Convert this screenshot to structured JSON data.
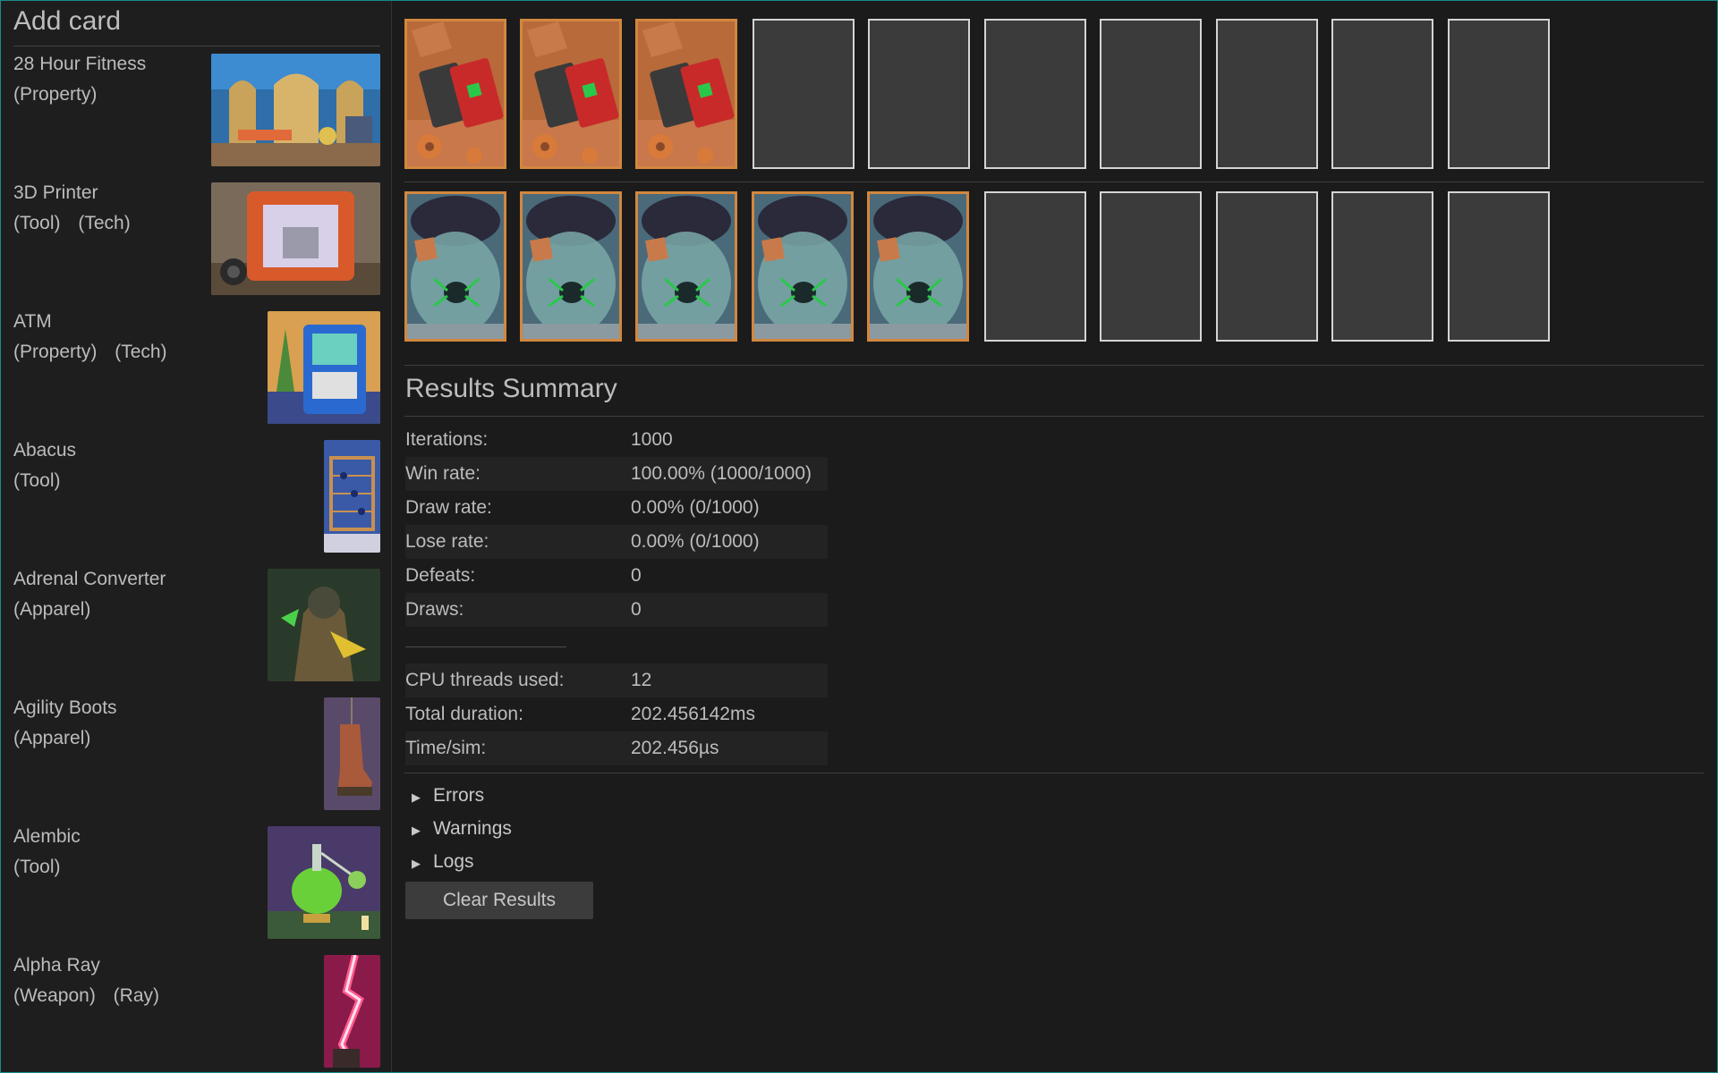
{
  "sidebar": {
    "title": "Add card",
    "cards": [
      {
        "name": "28 Hour Fitness",
        "tags": [
          "(Property)"
        ],
        "icon": "gym-card-art"
      },
      {
        "name": "3D Printer",
        "tags": [
          "(Tool)",
          "(Tech)"
        ],
        "icon": "printer-card-art"
      },
      {
        "name": "ATM",
        "tags": [
          "(Property)",
          "(Tech)"
        ],
        "icon": "atm-card-art"
      },
      {
        "name": "Abacus",
        "tags": [
          "(Tool)"
        ],
        "icon": "abacus-card-art"
      },
      {
        "name": "Adrenal Converter",
        "tags": [
          "(Apparel)"
        ],
        "icon": "converter-card-art"
      },
      {
        "name": "Agility Boots",
        "tags": [
          "(Apparel)"
        ],
        "icon": "boots-card-art"
      },
      {
        "name": "Alembic",
        "tags": [
          "(Tool)"
        ],
        "icon": "alembic-card-art"
      },
      {
        "name": "Alpha Ray",
        "tags": [
          "(Weapon)",
          "(Ray)"
        ],
        "icon": "ray-card-art"
      }
    ]
  },
  "board": {
    "top_row": {
      "filled": 3,
      "total": 10,
      "card_icon": "lighter-card-art"
    },
    "bottom_row": {
      "filled": 5,
      "total": 10,
      "card_icon": "spider-jar-card-art"
    }
  },
  "results": {
    "title": "Results Summary",
    "stats": [
      {
        "label": "Iterations:",
        "value": "1000"
      },
      {
        "label": "Win rate:",
        "value": "100.00% (1000/1000)"
      },
      {
        "label": "Draw rate:",
        "value": "0.00% (0/1000)"
      },
      {
        "label": "Lose rate:",
        "value": "0.00% (0/1000)"
      },
      {
        "label": "Defeats:",
        "value": "0"
      },
      {
        "label": "Draws:",
        "value": "0"
      }
    ],
    "perf": [
      {
        "label": "CPU threads used:",
        "value": "12"
      },
      {
        "label": "Total duration:",
        "value": "202.456142ms"
      },
      {
        "label": "Time/sim:",
        "value": "202.456µs"
      }
    ],
    "sections": [
      {
        "label": "Errors",
        "expanded": false
      },
      {
        "label": "Warnings",
        "expanded": false
      },
      {
        "label": "Logs",
        "expanded": false
      }
    ],
    "clear_label": "Clear Results"
  },
  "colors": {
    "accent_border": "#d2873e",
    "empty_slot": "#3b3b3b",
    "window_border": "#1a8a8a"
  }
}
